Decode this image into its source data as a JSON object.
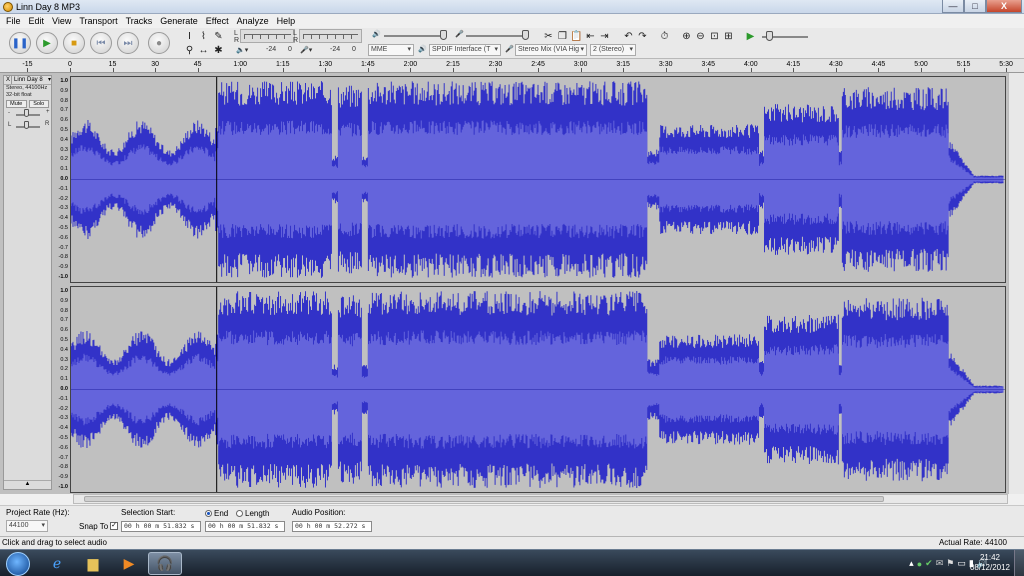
{
  "window": {
    "title": "Linn Day 8 MP3",
    "controls": [
      "—",
      "□",
      "X"
    ]
  },
  "menu": [
    "File",
    "Edit",
    "View",
    "Transport",
    "Tracks",
    "Generate",
    "Effect",
    "Analyze",
    "Help"
  ],
  "transport": {
    "buttons": [
      {
        "name": "pause",
        "glyph": "❚❚",
        "color": "#2a63c9"
      },
      {
        "name": "play",
        "glyph": "▶",
        "color": "#2c9a2c"
      },
      {
        "name": "stop",
        "glyph": "■",
        "color": "#d79a13"
      },
      {
        "name": "skip-start",
        "glyph": "⏮",
        "color": "#7a8aa8"
      },
      {
        "name": "skip-end",
        "glyph": "⏭",
        "color": "#7a8aa8"
      },
      {
        "name": "record",
        "glyph": "●",
        "color": "#8a8a8a"
      }
    ]
  },
  "meters": {
    "play_left": "L",
    "play_right": "R",
    "rec_left": "L",
    "rec_right": "R",
    "play_db": [
      "-24",
      "0"
    ],
    "rec_db": [
      "-24",
      "0"
    ]
  },
  "devices": {
    "host": "MME",
    "output": "SPDIF Interface (T",
    "input": "Stereo Mix (VIA Hig",
    "channels": "2 (Stereo)"
  },
  "ruler_ticks": [
    "-15",
    "0",
    "15",
    "30",
    "45",
    "1:00",
    "1:15",
    "1:30",
    "1:45",
    "2:00",
    "2:15",
    "2:30",
    "2:45",
    "3:00",
    "3:15",
    "3:30",
    "3:45",
    "4:00",
    "4:15",
    "4:30",
    "4:45",
    "5:00",
    "5:15",
    "5:30"
  ],
  "track": {
    "name": "Linn Day 8",
    "close": "X",
    "menu_arrow": "▾",
    "format": "Stereo, 44100Hz",
    "bits": "32-bit float",
    "mute": "Mute",
    "solo": "Solo",
    "gain_minus": "-",
    "gain_plus": "+",
    "pan_left": "L",
    "pan_right": "R",
    "collapse": "▲"
  },
  "vscale": [
    "1.0",
    "0.9",
    "0.8",
    "0.7",
    "0.6",
    "0.5",
    "0.4",
    "0.3",
    "0.2",
    "0.1",
    "0.0",
    "-0.1",
    "-0.2",
    "-0.3",
    "-0.4",
    "-0.5",
    "-0.6",
    "-0.7",
    "-0.8",
    "-0.9",
    "-1.0"
  ],
  "selection_bar": {
    "project_rate_label": "Project Rate (Hz):",
    "project_rate": "44100",
    "snap_to_label": "Snap To",
    "snap_checked": "✓",
    "selection_start_label": "Selection Start:",
    "end_label": "End",
    "length_label": "Length",
    "selection_start": "00 h 00 m 51.832 s",
    "selection_end": "00 h 00 m 51.832 s",
    "audio_position_label": "Audio Position:",
    "audio_position": "00 h 00 m 52.272 s"
  },
  "status": {
    "left": "Click and drag to select audio",
    "right": "Actual Rate: 44100"
  },
  "taskbar": {
    "apps": [
      "ie",
      "explorer",
      "media-player",
      "audacity"
    ],
    "time": "21:42",
    "date": "08/12/2012"
  },
  "colors": {
    "waveform": "#3232c8",
    "waveform_rms": "#6464dc",
    "track_bg": "#c0c0c0"
  }
}
